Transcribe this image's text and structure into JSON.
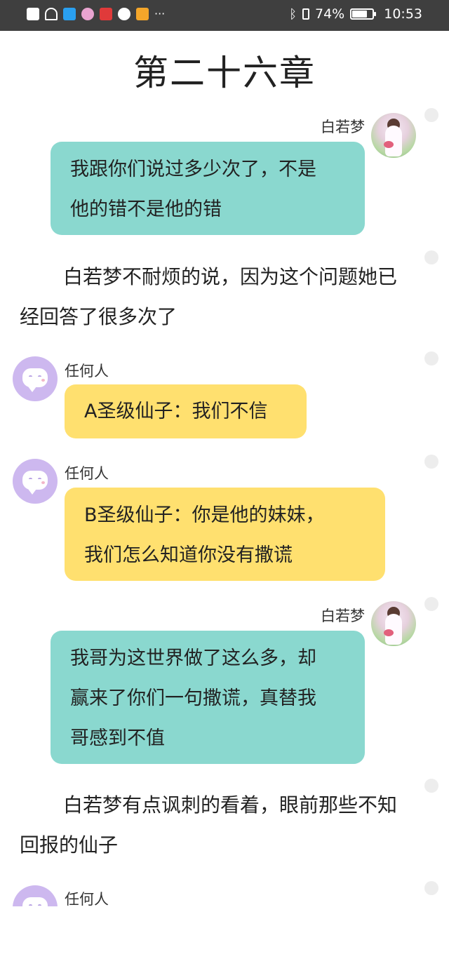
{
  "status_bar": {
    "battery": "74%",
    "battery_level": 0.74,
    "time": "10:53",
    "overflow": "···"
  },
  "chapter": {
    "title": "第二十六章"
  },
  "messages": [
    {
      "speaker": "白若梦",
      "lines": [
        "我跟你们说过多少次了，不是",
        "他的错不是他的错"
      ]
    },
    {
      "narration": "白若梦不耐烦的说，因为这个问题她已经回答了很多次了"
    },
    {
      "speaker": "任何人",
      "lines": [
        "A圣级仙子：我们不信"
      ]
    },
    {
      "speaker": "任何人",
      "lines": [
        "B圣级仙子：你是他的妹妹，",
        "我们怎么知道你没有撒谎"
      ]
    },
    {
      "speaker": "白若梦",
      "lines": [
        "我哥为这世界做了这么多，却",
        "赢来了你们一句撒谎，真替我",
        "哥感到不值"
      ]
    },
    {
      "narration": "白若梦有点讽刺的看着，眼前那些不知回报的仙子"
    },
    {
      "speaker": "任何人"
    }
  ],
  "colors": {
    "status_bar": "#3f3f3f",
    "bubble_teal": "#8ad8cf",
    "bubble_yellow": "#ffe06f",
    "avatar_default": "#cdb8ef"
  }
}
